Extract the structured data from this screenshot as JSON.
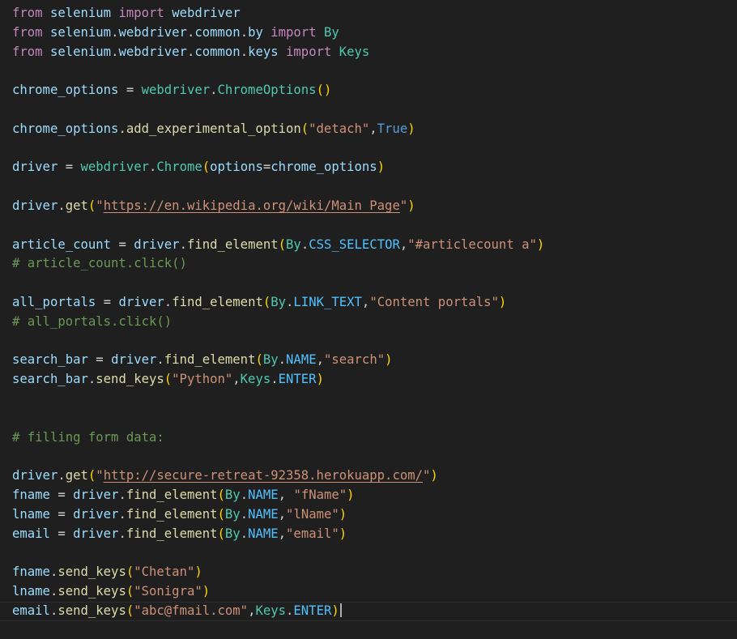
{
  "editor": {
    "theme_colors": {
      "background": "#1f1f1f",
      "keyword": "#c586c0",
      "variable": "#9cdcfe",
      "class": "#4ec9b0",
      "function": "#dcdcaa",
      "string": "#ce9178",
      "constant": "#4fc1ff",
      "boolean": "#569cd6",
      "bracket": "#ffd700",
      "comment": "#6a9955"
    },
    "lines": [
      [
        [
          "kw",
          "from"
        ],
        [
          "plain",
          " "
        ],
        [
          "var",
          "selenium"
        ],
        [
          "plain",
          " "
        ],
        [
          "kw",
          "import"
        ],
        [
          "plain",
          " "
        ],
        [
          "var",
          "webdriver"
        ]
      ],
      [
        [
          "kw",
          "from"
        ],
        [
          "plain",
          " "
        ],
        [
          "var",
          "selenium"
        ],
        [
          "pun",
          "."
        ],
        [
          "var",
          "webdriver"
        ],
        [
          "pun",
          "."
        ],
        [
          "var",
          "common"
        ],
        [
          "pun",
          "."
        ],
        [
          "var",
          "by"
        ],
        [
          "plain",
          " "
        ],
        [
          "kw",
          "import"
        ],
        [
          "plain",
          " "
        ],
        [
          "cls",
          "By"
        ]
      ],
      [
        [
          "kw",
          "from"
        ],
        [
          "plain",
          " "
        ],
        [
          "var",
          "selenium"
        ],
        [
          "pun",
          "."
        ],
        [
          "var",
          "webdriver"
        ],
        [
          "pun",
          "."
        ],
        [
          "var",
          "common"
        ],
        [
          "pun",
          "."
        ],
        [
          "var",
          "keys"
        ],
        [
          "plain",
          " "
        ],
        [
          "kw",
          "import"
        ],
        [
          "plain",
          " "
        ],
        [
          "cls",
          "Keys"
        ]
      ],
      [],
      [
        [
          "var",
          "chrome_options"
        ],
        [
          "plain",
          " "
        ],
        [
          "op",
          "="
        ],
        [
          "plain",
          " "
        ],
        [
          "cls",
          "webdriver"
        ],
        [
          "pun",
          "."
        ],
        [
          "cls",
          "ChromeOptions"
        ],
        [
          "br1",
          "()"
        ]
      ],
      [],
      [
        [
          "var",
          "chrome_options"
        ],
        [
          "pun",
          "."
        ],
        [
          "fn",
          "add_experimental_option"
        ],
        [
          "br1",
          "("
        ],
        [
          "str",
          "\"detach\""
        ],
        [
          "pun",
          ","
        ],
        [
          "bool",
          "True"
        ],
        [
          "br1",
          ")"
        ]
      ],
      [],
      [
        [
          "var",
          "driver"
        ],
        [
          "plain",
          " "
        ],
        [
          "op",
          "="
        ],
        [
          "plain",
          " "
        ],
        [
          "cls",
          "webdriver"
        ],
        [
          "pun",
          "."
        ],
        [
          "cls",
          "Chrome"
        ],
        [
          "br1",
          "("
        ],
        [
          "var",
          "options"
        ],
        [
          "op",
          "="
        ],
        [
          "var",
          "chrome_options"
        ],
        [
          "br1",
          ")"
        ]
      ],
      [],
      [
        [
          "var",
          "driver"
        ],
        [
          "pun",
          "."
        ],
        [
          "fn",
          "get"
        ],
        [
          "br1",
          "("
        ],
        [
          "str",
          "\""
        ],
        [
          "url",
          "https://en.wikipedia.org/wiki/Main_Page"
        ],
        [
          "str",
          "\""
        ],
        [
          "br1",
          ")"
        ]
      ],
      [],
      [
        [
          "var",
          "article_count"
        ],
        [
          "plain",
          " "
        ],
        [
          "op",
          "="
        ],
        [
          "plain",
          " "
        ],
        [
          "var",
          "driver"
        ],
        [
          "pun",
          "."
        ],
        [
          "fn",
          "find_element"
        ],
        [
          "br1",
          "("
        ],
        [
          "cls",
          "By"
        ],
        [
          "pun",
          "."
        ],
        [
          "const",
          "CSS_SELECTOR"
        ],
        [
          "pun",
          ","
        ],
        [
          "str",
          "\"#articlecount a\""
        ],
        [
          "br1",
          ")"
        ]
      ],
      [
        [
          "cmt",
          "# article_count.click()"
        ]
      ],
      [],
      [
        [
          "var",
          "all_portals"
        ],
        [
          "plain",
          " "
        ],
        [
          "op",
          "="
        ],
        [
          "plain",
          " "
        ],
        [
          "var",
          "driver"
        ],
        [
          "pun",
          "."
        ],
        [
          "fn",
          "find_element"
        ],
        [
          "br1",
          "("
        ],
        [
          "cls",
          "By"
        ],
        [
          "pun",
          "."
        ],
        [
          "const",
          "LINK_TEXT"
        ],
        [
          "pun",
          ","
        ],
        [
          "str",
          "\"Content portals\""
        ],
        [
          "br1",
          ")"
        ]
      ],
      [
        [
          "cmt",
          "# all_portals.click()"
        ]
      ],
      [],
      [
        [
          "var",
          "search_bar"
        ],
        [
          "plain",
          " "
        ],
        [
          "op",
          "="
        ],
        [
          "plain",
          " "
        ],
        [
          "var",
          "driver"
        ],
        [
          "pun",
          "."
        ],
        [
          "fn",
          "find_element"
        ],
        [
          "br1",
          "("
        ],
        [
          "cls",
          "By"
        ],
        [
          "pun",
          "."
        ],
        [
          "const",
          "NAME"
        ],
        [
          "pun",
          ","
        ],
        [
          "str",
          "\"search\""
        ],
        [
          "br1",
          ")"
        ]
      ],
      [
        [
          "var",
          "search_bar"
        ],
        [
          "pun",
          "."
        ],
        [
          "fn",
          "send_keys"
        ],
        [
          "br1",
          "("
        ],
        [
          "str",
          "\"Python\""
        ],
        [
          "pun",
          ","
        ],
        [
          "cls",
          "Keys"
        ],
        [
          "pun",
          "."
        ],
        [
          "const",
          "ENTER"
        ],
        [
          "br1",
          ")"
        ]
      ],
      [],
      [],
      [
        [
          "cmt",
          "# filling form data:"
        ]
      ],
      [],
      [
        [
          "var",
          "driver"
        ],
        [
          "pun",
          "."
        ],
        [
          "fn",
          "get"
        ],
        [
          "br1",
          "("
        ],
        [
          "str",
          "\""
        ],
        [
          "url",
          "http://secure-retreat-92358.herokuapp.com/"
        ],
        [
          "str",
          "\""
        ],
        [
          "br1",
          ")"
        ]
      ],
      [
        [
          "var",
          "fname"
        ],
        [
          "plain",
          " "
        ],
        [
          "op",
          "="
        ],
        [
          "plain",
          " "
        ],
        [
          "var",
          "driver"
        ],
        [
          "pun",
          "."
        ],
        [
          "fn",
          "find_element"
        ],
        [
          "br1",
          "("
        ],
        [
          "cls",
          "By"
        ],
        [
          "pun",
          "."
        ],
        [
          "const",
          "NAME"
        ],
        [
          "pun",
          ","
        ],
        [
          "plain",
          " "
        ],
        [
          "str",
          "\"fName\""
        ],
        [
          "br1",
          ")"
        ]
      ],
      [
        [
          "var",
          "lname"
        ],
        [
          "plain",
          " "
        ],
        [
          "op",
          "="
        ],
        [
          "plain",
          " "
        ],
        [
          "var",
          "driver"
        ],
        [
          "pun",
          "."
        ],
        [
          "fn",
          "find_element"
        ],
        [
          "br1",
          "("
        ],
        [
          "cls",
          "By"
        ],
        [
          "pun",
          "."
        ],
        [
          "const",
          "NAME"
        ],
        [
          "pun",
          ","
        ],
        [
          "str",
          "\"lName\""
        ],
        [
          "br1",
          ")"
        ]
      ],
      [
        [
          "var",
          "email"
        ],
        [
          "plain",
          " "
        ],
        [
          "op",
          "="
        ],
        [
          "plain",
          " "
        ],
        [
          "var",
          "driver"
        ],
        [
          "pun",
          "."
        ],
        [
          "fn",
          "find_element"
        ],
        [
          "br1",
          "("
        ],
        [
          "cls",
          "By"
        ],
        [
          "pun",
          "."
        ],
        [
          "const",
          "NAME"
        ],
        [
          "pun",
          ","
        ],
        [
          "str",
          "\"email\""
        ],
        [
          "br1",
          ")"
        ]
      ],
      [],
      [
        [
          "var",
          "fname"
        ],
        [
          "pun",
          "."
        ],
        [
          "fn",
          "send_keys"
        ],
        [
          "br1",
          "("
        ],
        [
          "str",
          "\"Chetan\""
        ],
        [
          "br1",
          ")"
        ]
      ],
      [
        [
          "var",
          "lname"
        ],
        [
          "pun",
          "."
        ],
        [
          "fn",
          "send_keys"
        ],
        [
          "br1",
          "("
        ],
        [
          "str",
          "\"Sonigra\""
        ],
        [
          "br1",
          ")"
        ]
      ],
      [
        [
          "var",
          "email"
        ],
        [
          "pun",
          "."
        ],
        [
          "fn",
          "send_keys"
        ],
        [
          "br1",
          "("
        ],
        [
          "str",
          "\"abc@fmail.com\""
        ],
        [
          "pun",
          ","
        ],
        [
          "cls",
          "Keys"
        ],
        [
          "pun",
          "."
        ],
        [
          "const",
          "ENTER"
        ],
        [
          "br1",
          ")"
        ]
      ]
    ],
    "current_line": 31
  }
}
